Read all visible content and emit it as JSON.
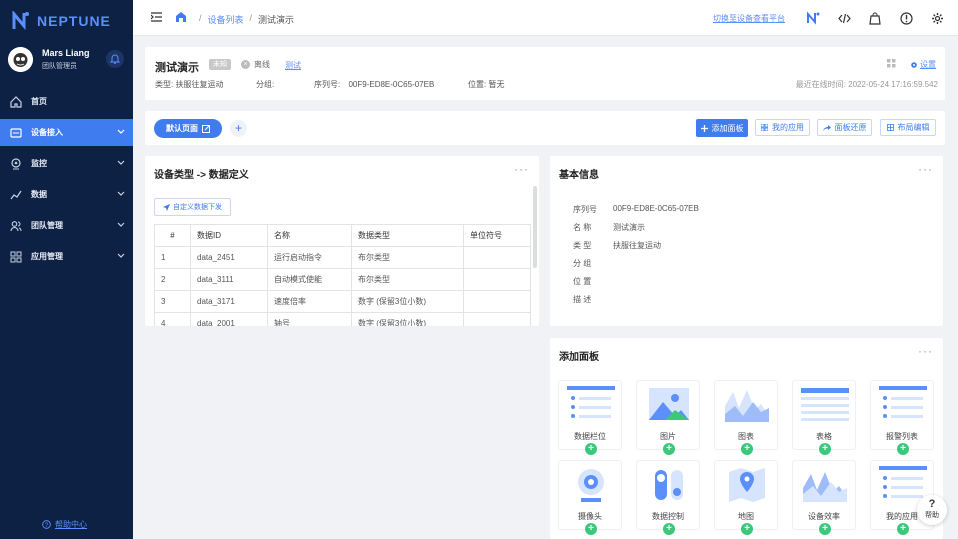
{
  "brand": {
    "name": "NEPTUNE"
  },
  "user": {
    "name": "Mars Liang",
    "role": "团队管理员"
  },
  "sidebar": {
    "items": [
      {
        "label": "首页",
        "icon": "home-icon"
      },
      {
        "label": "设备接入",
        "icon": "device-icon",
        "active": true
      },
      {
        "label": "监控",
        "icon": "monitor-icon"
      },
      {
        "label": "数据",
        "icon": "chart-icon"
      },
      {
        "label": "团队管理",
        "icon": "team-icon"
      },
      {
        "label": "应用管理",
        "icon": "apps-icon"
      }
    ],
    "help": "帮助中心"
  },
  "header": {
    "breadcrumb": [
      "设备列表",
      "测试演示"
    ],
    "switch_link": "切换至设备查看平台"
  },
  "device": {
    "title": "测试演示",
    "tag": "未知",
    "status": "离线",
    "test_link": "测试",
    "settings": "设置",
    "type_label": "类型:",
    "type_value": "扶服往复运动",
    "group_label": "分组:",
    "group_value": "",
    "serial_label": "序列号:",
    "serial_value": "00F9-ED8E-0C65-07EB",
    "location_label": "位置:",
    "location_value": "暂无",
    "last_online": "最近在线时间: 2022-05-24 17:16:59.542"
  },
  "toolbar": {
    "default_page": "默认页面",
    "add_panel": "添加面板",
    "my_apps": "我的应用",
    "restore": "面板还原",
    "layout": "布局编辑"
  },
  "data_def": {
    "title": "设备类型 -> 数据定义",
    "custom_btn": "自定义数据下发",
    "headers": [
      "#",
      "数据ID",
      "名称",
      "数据类型",
      "单位符号"
    ],
    "rows": [
      [
        "1",
        "data_2451",
        "运行启动指令",
        "布尔类型",
        ""
      ],
      [
        "2",
        "data_3111",
        "自动模式使能",
        "布尔类型",
        ""
      ],
      [
        "3",
        "data_3171",
        "速度倍率",
        "数字 (保留3位小数)",
        ""
      ],
      [
        "4",
        "data_2001",
        "轴号",
        "数字 (保留3位小数)",
        ""
      ]
    ]
  },
  "basic_info": {
    "title": "基本信息",
    "rows": [
      {
        "label": "序列号",
        "value": "00F9-ED8E-0C65-07EB"
      },
      {
        "label": "名 称",
        "value": "测试演示"
      },
      {
        "label": "类 型",
        "value": "扶服往复运动"
      },
      {
        "label": "分 组",
        "value": ""
      },
      {
        "label": "位 置",
        "value": ""
      },
      {
        "label": "描 述",
        "value": ""
      }
    ]
  },
  "add_panel": {
    "title": "添加面板",
    "widgets": [
      "数据栏位",
      "图片",
      "图表",
      "表格",
      "报警列表",
      "摄像头",
      "数据控制",
      "地图",
      "设备效率",
      "我的应用"
    ]
  },
  "help_float": {
    "label": "帮助"
  },
  "colors": {
    "primary": "#3f7cf0",
    "sidebar": "#0d2145",
    "success": "#3cc77a"
  }
}
